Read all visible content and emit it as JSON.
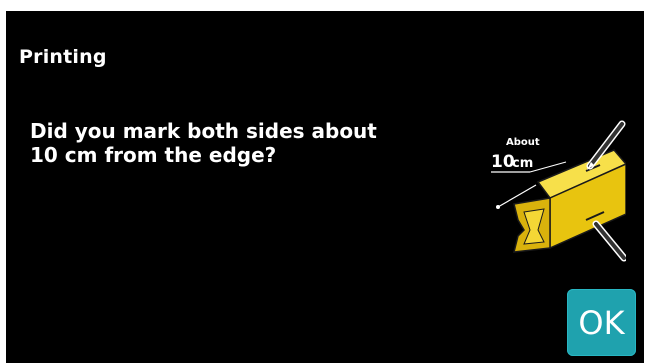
{
  "header": {
    "title": "Printing"
  },
  "dialog": {
    "message_line1": "Did you mark both sides about",
    "message_line2": "10 cm from the edge?"
  },
  "illustration": {
    "label_about": "About",
    "label_distance_value": "10",
    "label_distance_unit": "cm",
    "icon": "marked-wood-beam-icon"
  },
  "buttons": {
    "ok_label": "OK"
  },
  "colors": {
    "background": "#000000",
    "text": "#ffffff",
    "ok_button": "#1fa2ae",
    "beam": "#f2d216"
  }
}
